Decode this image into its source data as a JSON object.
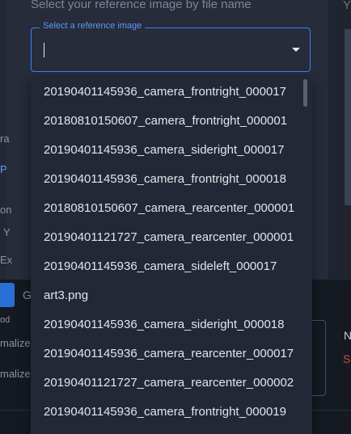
{
  "page": {
    "prompt": "Select your reference image by file name",
    "right_fragment": "Y"
  },
  "select": {
    "label": "Select a reference image",
    "value": "",
    "options": [
      "20190401145936_camera_frontright_000017",
      "20180810150607_camera_frontright_000001",
      "20190401145936_camera_sideright_000017",
      "20190401145936_camera_frontright_000018",
      "20180810150607_camera_rearcenter_000001",
      "20190401121727_camera_rearcenter_000001",
      "20190401145936_camera_sideleft_000017",
      "art3.png",
      "20190401145936_camera_sideright_000018",
      "20190401145936_camera_rearcenter_000017",
      "20190401121727_camera_rearcenter_000002",
      "20190401145936_camera_frontright_000019"
    ]
  },
  "background": {
    "fragments": [
      "ra",
      "P",
      "on",
      "Y",
      "Ex",
      "G",
      "od",
      "malize",
      "malize",
      "N",
      "S"
    ]
  },
  "colors": {
    "accent": "#3b82f6",
    "menu_bg": "#222836",
    "text": "#e3e5e9"
  }
}
